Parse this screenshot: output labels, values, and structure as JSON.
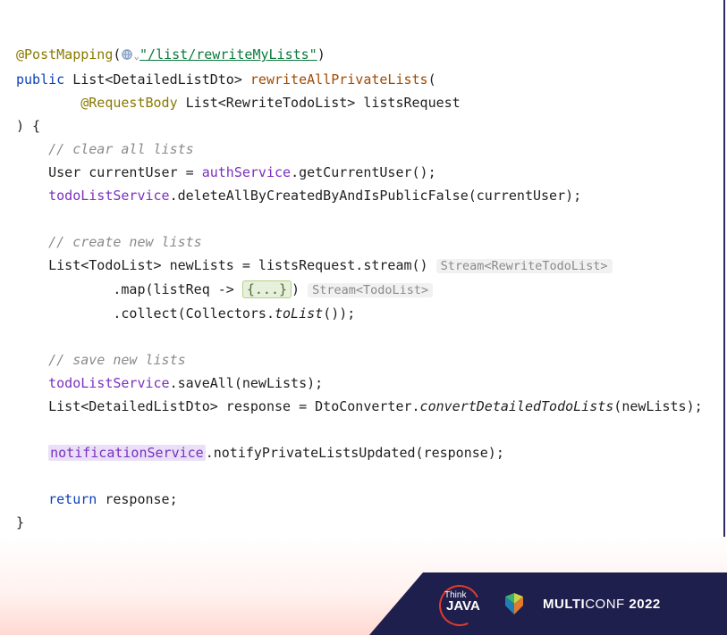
{
  "code": {
    "annotation": "@PostMapping",
    "url_string": "\"/list/rewriteMyLists\"",
    "kw_public": "public",
    "ret_type": "List<DetailedListDto>",
    "method_name": "rewriteAllPrivateLists",
    "param_ann": "@RequestBody",
    "param_type": "List<RewriteTodoList>",
    "param_name": "listsRequest",
    "c_clear": "// clear all lists",
    "l_user": "User currentUser = ",
    "authService": "authService",
    "l_user_tail": ".getCurrentUser();",
    "todoListService": "todoListService",
    "l_delete_tail": ".deleteAllByCreatedByAndIsPublicFalse(currentUser);",
    "c_create": "// create new lists",
    "l_newlists_head": "List<TodoList> newLists = listsRequest.stream()",
    "hint_stream1": "Stream<RewriteTodoList>",
    "l_map_head": ".map(listReq -> ",
    "fold": "{...}",
    "l_map_tail": ")",
    "hint_stream2": "Stream<TodoList>",
    "l_collect_head": ".collect(Collectors.",
    "l_collect_ital": "toList",
    "l_collect_tail": "());",
    "c_save": "// save new lists",
    "l_saveall_tail": ".saveAll(newLists);",
    "l_resp_head": "List<DetailedListDto> response = DtoConverter.",
    "l_resp_ital": "convertDetailedTodoLists",
    "l_resp_tail": "(newLists);",
    "notificationService": "notificationService",
    "l_notify_tail": ".notifyPrivateListsUpdated(response);",
    "kw_return": "return",
    "ret_stmt_tail": " response;"
  },
  "footer": {
    "think": "Think",
    "java": "JAVA",
    "multi": "MULTI",
    "conf": "CONF ",
    "year": "2022"
  }
}
